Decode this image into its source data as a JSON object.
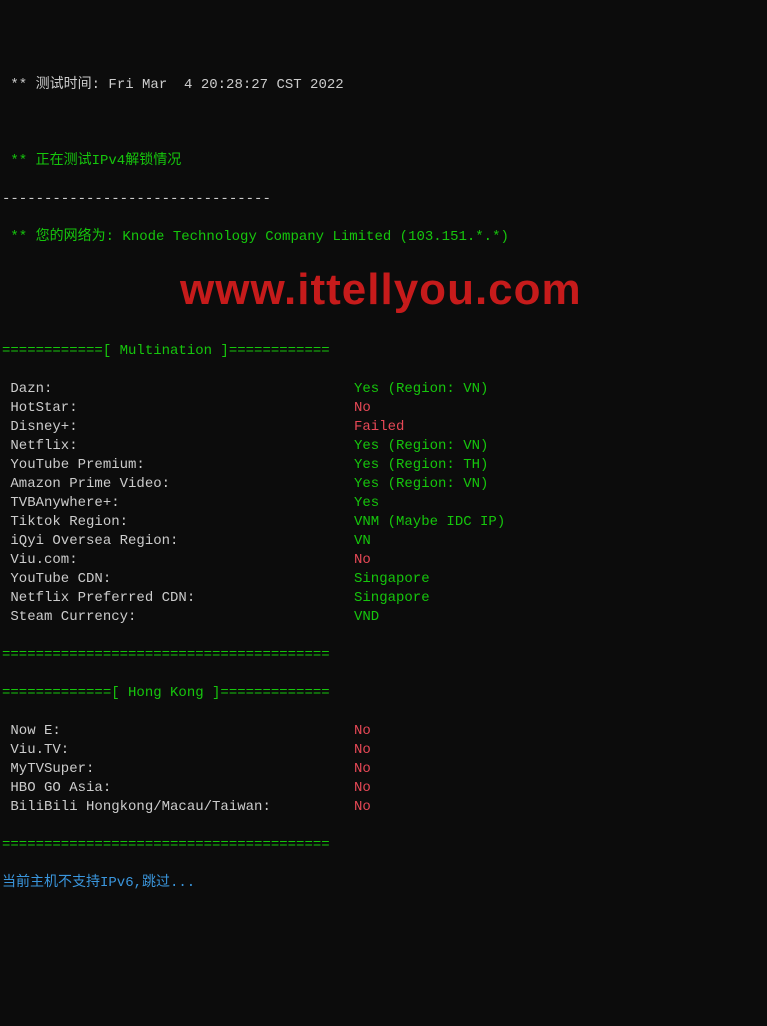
{
  "header": {
    "test_time_prefix": " ** 测试时间: ",
    "test_time_value": "Fri Mar  4 20:28:27 CST 2022",
    "ipv4_test": " ** 正在测试IPv4解锁情况",
    "divider": "--------------------------------",
    "network_prefix": " ** 您的网络为: ",
    "network_value": "Knode Technology Company Limited (103.151.*.*)"
  },
  "section_multination": {
    "header": "============[ Multination ]============",
    "rows": [
      {
        "name": " Dazn:",
        "value": "Yes (Region: VN)",
        "cls": "green"
      },
      {
        "name": " HotStar:",
        "value": "No",
        "cls": "red"
      },
      {
        "name": " Disney+:",
        "value": "Failed",
        "cls": "red"
      },
      {
        "name": " Netflix:",
        "value": "Yes (Region: VN)",
        "cls": "green"
      },
      {
        "name": " YouTube Premium:",
        "value": "Yes (Region: TH)",
        "cls": "green"
      },
      {
        "name": " Amazon Prime Video:",
        "value": "Yes (Region: VN)",
        "cls": "green"
      },
      {
        "name": " TVBAnywhere+:",
        "value": "Yes",
        "cls": "green"
      },
      {
        "name": " Tiktok Region:",
        "value": "VNM (Maybe IDC IP)",
        "cls": "green"
      },
      {
        "name": " iQyi Oversea Region:",
        "value": "VN",
        "cls": "green"
      },
      {
        "name": " Viu.com:",
        "value": "No",
        "cls": "red"
      },
      {
        "name": " YouTube CDN:",
        "value": "Singapore",
        "cls": "green"
      },
      {
        "name": " Netflix Preferred CDN:",
        "value": "Singapore",
        "cls": "green"
      },
      {
        "name": " Steam Currency:",
        "value": "VND",
        "cls": "green"
      }
    ],
    "footer": "======================================="
  },
  "section_hongkong": {
    "header": "=============[ Hong Kong ]=============",
    "rows": [
      {
        "name": " Now E:",
        "value": "No",
        "cls": "red"
      },
      {
        "name": " Viu.TV:",
        "value": "No",
        "cls": "red"
      },
      {
        "name": " MyTVSuper:",
        "value": "No",
        "cls": "red"
      },
      {
        "name": " HBO GO Asia:",
        "value": "No",
        "cls": "red"
      },
      {
        "name": " BiliBili Hongkong/Macau/Taiwan:",
        "value": "No",
        "cls": "red"
      }
    ],
    "footer": "======================================="
  },
  "ipv6_msg": "当前主机不支持IPv6,跳过...",
  "watermark": "www.ittellyou.com"
}
